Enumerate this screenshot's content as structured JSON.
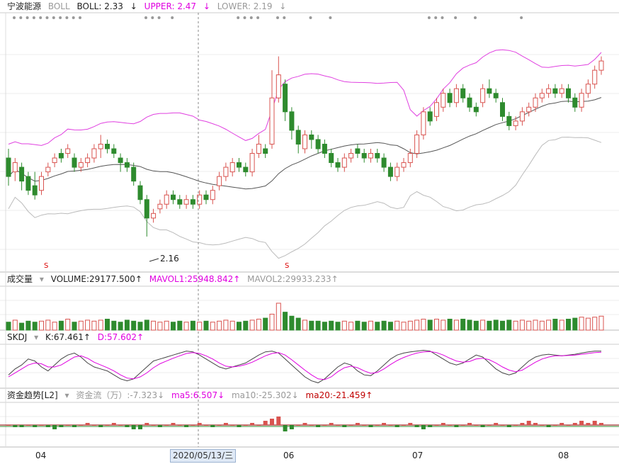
{
  "main_header": {
    "stock": "宁波能源",
    "indicator": "BOLL",
    "boll": "BOLL: 2.33",
    "upper": "UPPER: 2.47",
    "lower": "LOWER: 2.19",
    "arrow": "↓"
  },
  "vol_header": {
    "name": "成交量",
    "volume": "VOLUME:29177.500↑",
    "mavol1": "MAVOL1:25948.842↑",
    "mavol2": "MAVOL2:29933.233↑"
  },
  "skdj_header": {
    "name": "SKDJ",
    "k": "K:67.461↑",
    "d": "D:57.602↑"
  },
  "fund_header": {
    "name": "资金趋势[L2]",
    "flow": "资金流（万）:-7.323↓",
    "ma5": "ma5:6.507↓",
    "ma10": "ma10:-25.302↓",
    "ma20": "ma20:-21.459↑"
  },
  "annotations": {
    "low_label": "2.16",
    "s_marker": "S"
  },
  "time_axis": {
    "labels": [
      "04",
      "06",
      "07",
      "08"
    ],
    "cursor_date": "2020/05/13/三"
  },
  "colors": {
    "up": "#d9534f",
    "down": "#2e8b2e",
    "upper": "#e040e0",
    "mid": "#555555",
    "lower": "#bbbbbb",
    "k_line": "#444444",
    "d_line": "#e000e0"
  },
  "chart_data": {
    "type": "candlestick",
    "title": "宁波能源",
    "price_range": [
      2.12,
      2.58
    ],
    "lowest": 2.16,
    "candles": [
      [
        2.33,
        2.29,
        2.35,
        2.27
      ],
      [
        2.3,
        2.32,
        2.33,
        2.28
      ],
      [
        2.31,
        2.28,
        2.32,
        2.26
      ],
      [
        2.29,
        2.26,
        2.3,
        2.25
      ],
      [
        2.27,
        2.25,
        2.3,
        2.24
      ],
      [
        2.26,
        2.29,
        2.3,
        2.25
      ],
      [
        2.3,
        2.31,
        2.32,
        2.29
      ],
      [
        2.32,
        2.33,
        2.34,
        2.31
      ],
      [
        2.34,
        2.33,
        2.35,
        2.32
      ],
      [
        2.34,
        2.35,
        2.36,
        2.33
      ],
      [
        2.33,
        2.31,
        2.34,
        2.3
      ],
      [
        2.31,
        2.32,
        2.33,
        2.3
      ],
      [
        2.32,
        2.33,
        2.34,
        2.31
      ],
      [
        2.33,
        2.35,
        2.36,
        2.32
      ],
      [
        2.35,
        2.36,
        2.38,
        2.33
      ],
      [
        2.36,
        2.35,
        2.37,
        2.34
      ],
      [
        2.35,
        2.34,
        2.36,
        2.33
      ],
      [
        2.33,
        2.32,
        2.34,
        2.3
      ],
      [
        2.32,
        2.31,
        2.33,
        2.3
      ],
      [
        2.31,
        2.28,
        2.32,
        2.27
      ],
      [
        2.27,
        2.24,
        2.28,
        2.23
      ],
      [
        2.24,
        2.2,
        2.25,
        2.16
      ],
      [
        2.2,
        2.21,
        2.22,
        2.19
      ],
      [
        2.22,
        2.23,
        2.24,
        2.21
      ],
      [
        2.23,
        2.25,
        2.26,
        2.22
      ],
      [
        2.25,
        2.24,
        2.26,
        2.23
      ],
      [
        2.24,
        2.23,
        2.25,
        2.22
      ],
      [
        2.23,
        2.24,
        2.25,
        2.22
      ],
      [
        2.24,
        2.23,
        2.25,
        2.22
      ],
      [
        2.23,
        2.25,
        2.26,
        2.22
      ],
      [
        2.25,
        2.24,
        2.26,
        2.23
      ],
      [
        2.24,
        2.26,
        2.27,
        2.23
      ],
      [
        2.27,
        2.29,
        2.3,
        2.26
      ],
      [
        2.29,
        2.31,
        2.32,
        2.28
      ],
      [
        2.3,
        2.32,
        2.33,
        2.29
      ],
      [
        2.32,
        2.31,
        2.33,
        2.3
      ],
      [
        2.31,
        2.3,
        2.32,
        2.29
      ],
      [
        2.3,
        2.34,
        2.35,
        2.29
      ],
      [
        2.34,
        2.36,
        2.38,
        2.33
      ],
      [
        2.35,
        2.34,
        2.36,
        2.33
      ],
      [
        2.36,
        2.46,
        2.52,
        2.35
      ],
      [
        2.46,
        2.51,
        2.55,
        2.45
      ],
      [
        2.49,
        2.43,
        2.5,
        2.41
      ],
      [
        2.43,
        2.39,
        2.44,
        2.37
      ],
      [
        2.39,
        2.36,
        2.4,
        2.34
      ],
      [
        2.35,
        2.38,
        2.39,
        2.34
      ],
      [
        2.38,
        2.37,
        2.39,
        2.35
      ],
      [
        2.37,
        2.35,
        2.38,
        2.34
      ],
      [
        2.36,
        2.34,
        2.37,
        2.33
      ],
      [
        2.34,
        2.32,
        2.35,
        2.31
      ],
      [
        2.32,
        2.31,
        2.33,
        2.3
      ],
      [
        2.31,
        2.33,
        2.34,
        2.3
      ],
      [
        2.33,
        2.34,
        2.35,
        2.32
      ],
      [
        2.35,
        2.34,
        2.36,
        2.33
      ],
      [
        2.34,
        2.33,
        2.35,
        2.32
      ],
      [
        2.33,
        2.34,
        2.35,
        2.32
      ],
      [
        2.34,
        2.33,
        2.35,
        2.32
      ],
      [
        2.33,
        2.31,
        2.34,
        2.3
      ],
      [
        2.31,
        2.29,
        2.32,
        2.28
      ],
      [
        2.29,
        2.31,
        2.32,
        2.28
      ],
      [
        2.31,
        2.32,
        2.33,
        2.3
      ],
      [
        2.32,
        2.34,
        2.35,
        2.31
      ],
      [
        2.34,
        2.38,
        2.39,
        2.33
      ],
      [
        2.38,
        2.43,
        2.44,
        2.37
      ],
      [
        2.43,
        2.41,
        2.44,
        2.4
      ],
      [
        2.42,
        2.45,
        2.46,
        2.41
      ],
      [
        2.44,
        2.47,
        2.48,
        2.43
      ],
      [
        2.47,
        2.45,
        2.48,
        2.44
      ],
      [
        2.45,
        2.48,
        2.49,
        2.44
      ],
      [
        2.48,
        2.46,
        2.49,
        2.45
      ],
      [
        2.46,
        2.44,
        2.47,
        2.43
      ],
      [
        2.44,
        2.43,
        2.45,
        2.42
      ],
      [
        2.45,
        2.48,
        2.49,
        2.44
      ],
      [
        2.48,
        2.47,
        2.5,
        2.46
      ],
      [
        2.47,
        2.46,
        2.48,
        2.45
      ],
      [
        2.45,
        2.42,
        2.46,
        2.41
      ],
      [
        2.42,
        2.4,
        2.43,
        2.39
      ],
      [
        2.4,
        2.41,
        2.42,
        2.39
      ],
      [
        2.41,
        2.43,
        2.44,
        2.4
      ],
      [
        2.43,
        2.44,
        2.45,
        2.42
      ],
      [
        2.44,
        2.46,
        2.47,
        2.43
      ],
      [
        2.46,
        2.47,
        2.48,
        2.45
      ],
      [
        2.47,
        2.48,
        2.49,
        2.46
      ],
      [
        2.48,
        2.47,
        2.49,
        2.46
      ],
      [
        2.47,
        2.48,
        2.49,
        2.46
      ],
      [
        2.48,
        2.46,
        2.49,
        2.45
      ],
      [
        2.46,
        2.44,
        2.47,
        2.43
      ],
      [
        2.44,
        2.47,
        2.48,
        2.43
      ],
      [
        2.47,
        2.49,
        2.5,
        2.46
      ],
      [
        2.49,
        2.52,
        2.53,
        2.48
      ],
      [
        2.52,
        2.54,
        2.55,
        2.51
      ]
    ],
    "volumes": [
      8,
      10,
      7,
      9,
      8,
      9,
      10,
      8,
      9,
      11,
      8,
      9,
      10,
      9,
      10,
      11,
      9,
      8,
      10,
      9,
      8,
      10,
      9,
      8,
      9,
      8,
      9,
      8,
      9,
      8,
      9,
      8,
      9,
      10,
      9,
      8,
      9,
      10,
      11,
      12,
      16,
      27,
      18,
      14,
      12,
      10,
      9,
      9,
      8,
      9,
      8,
      9,
      8,
      9,
      8,
      9,
      8,
      9,
      8,
      9,
      8,
      9,
      10,
      11,
      10,
      11,
      10,
      11,
      10,
      11,
      10,
      9,
      10,
      9,
      10,
      9,
      10,
      9,
      10,
      9,
      10,
      9,
      10,
      11,
      10,
      11,
      12,
      13,
      12,
      13,
      14
    ],
    "k": [
      30,
      45,
      55,
      70,
      65,
      50,
      40,
      55,
      70,
      80,
      85,
      75,
      60,
      50,
      45,
      40,
      30,
      20,
      15,
      20,
      35,
      50,
      65,
      70,
      75,
      80,
      85,
      90,
      88,
      80,
      70,
      60,
      50,
      45,
      50,
      55,
      60,
      70,
      80,
      88,
      90,
      85,
      70,
      55,
      40,
      25,
      15,
      10,
      20,
      35,
      50,
      60,
      55,
      40,
      30,
      28,
      40,
      55,
      70,
      80,
      85,
      88,
      90,
      92,
      90,
      80,
      70,
      60,
      55,
      60,
      70,
      80,
      75,
      60,
      45,
      35,
      30,
      35,
      50,
      65,
      75,
      80,
      82,
      80,
      78,
      80,
      82,
      85,
      88,
      90,
      90
    ],
    "d": [
      25,
      35,
      45,
      55,
      60,
      58,
      50,
      50,
      55,
      65,
      75,
      78,
      72,
      62,
      55,
      48,
      40,
      30,
      22,
      20,
      25,
      35,
      48,
      58,
      65,
      72,
      78,
      84,
      86,
      84,
      78,
      70,
      60,
      52,
      50,
      52,
      56,
      62,
      70,
      78,
      84,
      86,
      80,
      68,
      55,
      42,
      30,
      20,
      18,
      25,
      38,
      48,
      52,
      48,
      40,
      34,
      36,
      45,
      56,
      66,
      74,
      80,
      85,
      88,
      89,
      86,
      80,
      72,
      65,
      62,
      64,
      70,
      72,
      68,
      60,
      50,
      42,
      38,
      42,
      52,
      62,
      70,
      75,
      78,
      78,
      79,
      80,
      82,
      84,
      86,
      87
    ],
    "fund": [
      0,
      -1,
      -1,
      0,
      -1,
      0,
      -1,
      -2,
      -1,
      0,
      -1,
      0,
      1,
      0,
      -1,
      0,
      1,
      0,
      -1,
      -2,
      -2,
      1,
      0,
      -1,
      0,
      1,
      0,
      -1,
      0,
      1,
      0,
      -1,
      0,
      1,
      0,
      -1,
      0,
      1,
      0,
      2,
      3,
      4,
      -3,
      -2,
      0,
      1,
      0,
      -1,
      0,
      1,
      0,
      -1,
      0,
      1,
      0,
      -1,
      0,
      1,
      0,
      -1,
      0,
      1,
      -1,
      -2,
      -1,
      0,
      1,
      0,
      -1,
      0,
      1,
      0,
      -1,
      0,
      1,
      0,
      -1,
      0,
      1,
      2,
      1,
      0,
      -1,
      0,
      1,
      0,
      1,
      2,
      1,
      2,
      1
    ]
  }
}
